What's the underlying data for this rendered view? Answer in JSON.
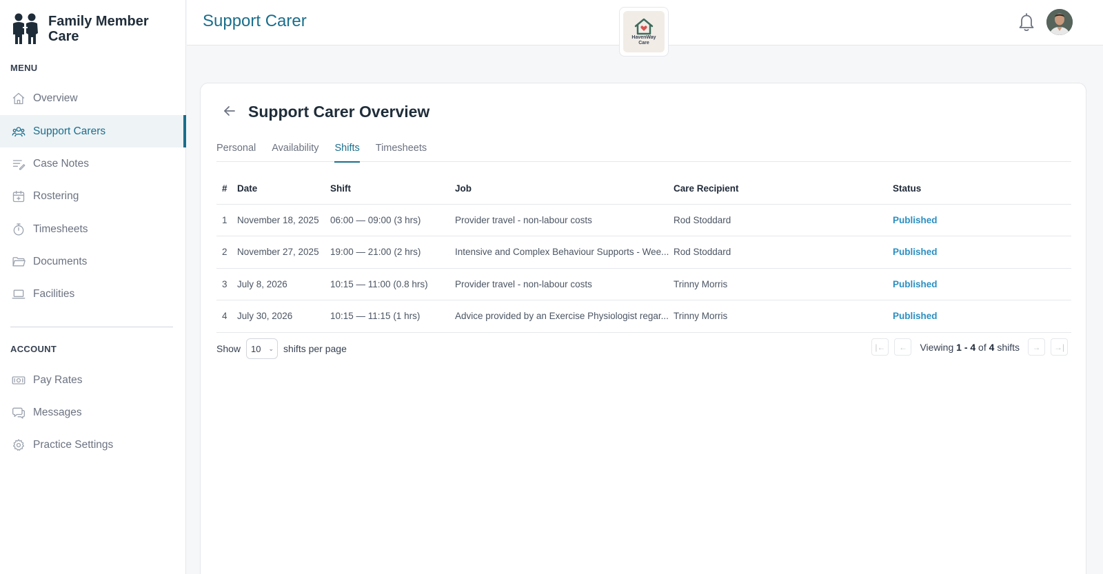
{
  "brand": {
    "name": "Family Member Care"
  },
  "sidebar": {
    "menu_label": "MENU",
    "items": [
      {
        "label": "Overview",
        "icon": "home-icon"
      },
      {
        "label": "Support Carers",
        "icon": "users-icon",
        "active": true
      },
      {
        "label": "Case Notes",
        "icon": "notes-icon"
      },
      {
        "label": "Rostering",
        "icon": "calendar-icon"
      },
      {
        "label": "Timesheets",
        "icon": "stopwatch-icon"
      },
      {
        "label": "Documents",
        "icon": "folder-icon"
      },
      {
        "label": "Facilities",
        "icon": "laptop-icon"
      }
    ],
    "account_label": "ACCOUNT",
    "account_items": [
      {
        "label": "Pay Rates",
        "icon": "cash-icon"
      },
      {
        "label": "Messages",
        "icon": "chat-icon"
      },
      {
        "label": "Practice Settings",
        "icon": "gear-icon"
      }
    ]
  },
  "header": {
    "title": "Support Carer",
    "center_logo": {
      "line1": "HavenWay",
      "line2": "Care"
    }
  },
  "main": {
    "title": "Support Carer Overview",
    "tabs": [
      "Personal",
      "Availability",
      "Shifts",
      "Timesheets"
    ],
    "active_tab": "Shifts",
    "table": {
      "columns": [
        "#",
        "Date",
        "Shift",
        "Job",
        "Care Recipient",
        "Status"
      ],
      "rows": [
        [
          "1",
          "November 18, 2025",
          "06:00 — 09:00 (3 hrs)",
          "Provider travel - non-labour costs",
          "Rod Stoddard",
          "Published"
        ],
        [
          "2",
          "November 27, 2025",
          "19:00 — 21:00 (2 hrs)",
          "Intensive and Complex Behaviour Supports - Wee...",
          "Rod Stoddard",
          "Published"
        ],
        [
          "3",
          "July 8, 2026",
          "10:15 — 11:00 (0.8 hrs)",
          "Provider travel - non-labour costs",
          "Trinny Morris",
          "Published"
        ],
        [
          "4",
          "July 30, 2026",
          "10:15 — 11:15 (1 hrs)",
          "Advice provided by an Exercise Physiologist regar...",
          "Trinny Morris",
          "Published"
        ]
      ]
    },
    "pager": {
      "show_label": "Show",
      "per_page_value": "10",
      "per_page_suffix": "shifts per page",
      "viewing_prefix": "Viewing",
      "range": "1 - 4",
      "of": "of",
      "total": "4",
      "unit": "shifts"
    }
  },
  "colors": {
    "accent": "#1a6e8c",
    "status_published": "#2a8fc2"
  }
}
